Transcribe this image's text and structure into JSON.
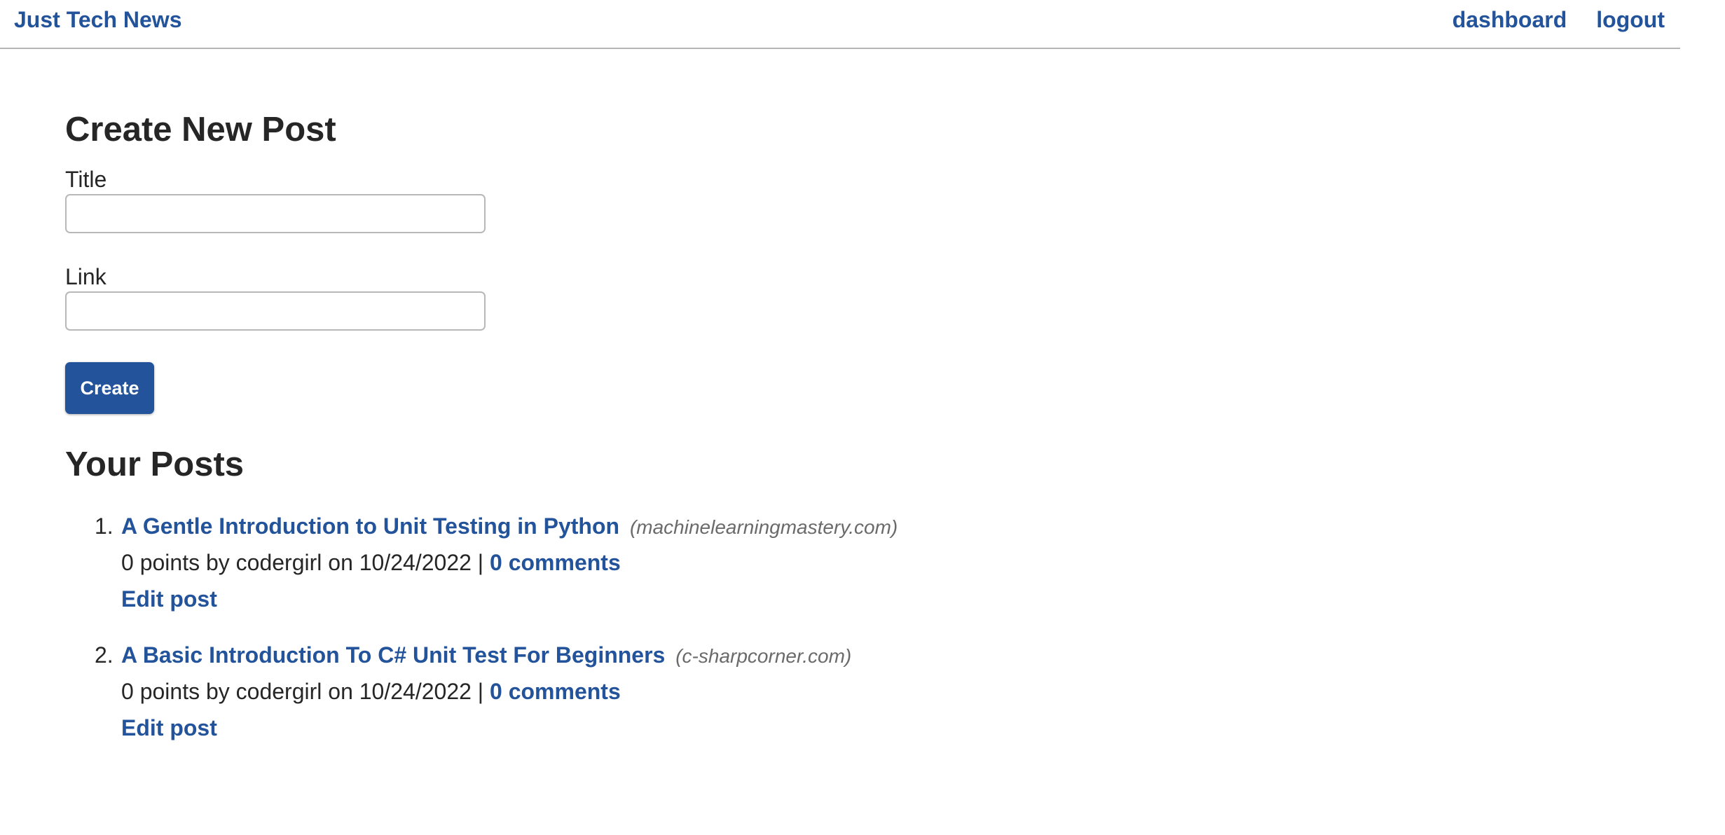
{
  "header": {
    "brand": "Just Tech News",
    "nav": {
      "dashboard": "dashboard",
      "logout": "logout"
    }
  },
  "form": {
    "heading": "Create New Post",
    "title_label": "Title",
    "title_value": "",
    "link_label": "Link",
    "link_value": "",
    "submit_label": "Create"
  },
  "posts_section": {
    "heading": "Your Posts",
    "posts": [
      {
        "number": "1.",
        "title": "A Gentle Introduction to Unit Testing in Python",
        "domain": "(machinelearningmastery.com)",
        "meta": "0 points by codergirl on 10/24/2022 |",
        "comments": "0 comments",
        "edit": "Edit post"
      },
      {
        "number": "2.",
        "title": "A Basic Introduction To C# Unit Test For Beginners",
        "domain": "(c-sharpcorner.com)",
        "meta": "0 points by codergirl on 10/24/2022 |",
        "comments": "0 comments",
        "edit": "Edit post"
      }
    ]
  },
  "colors": {
    "link": "#23539a",
    "text": "#262626",
    "domain": "#6a6a6a",
    "button_bg": "#23539a"
  }
}
